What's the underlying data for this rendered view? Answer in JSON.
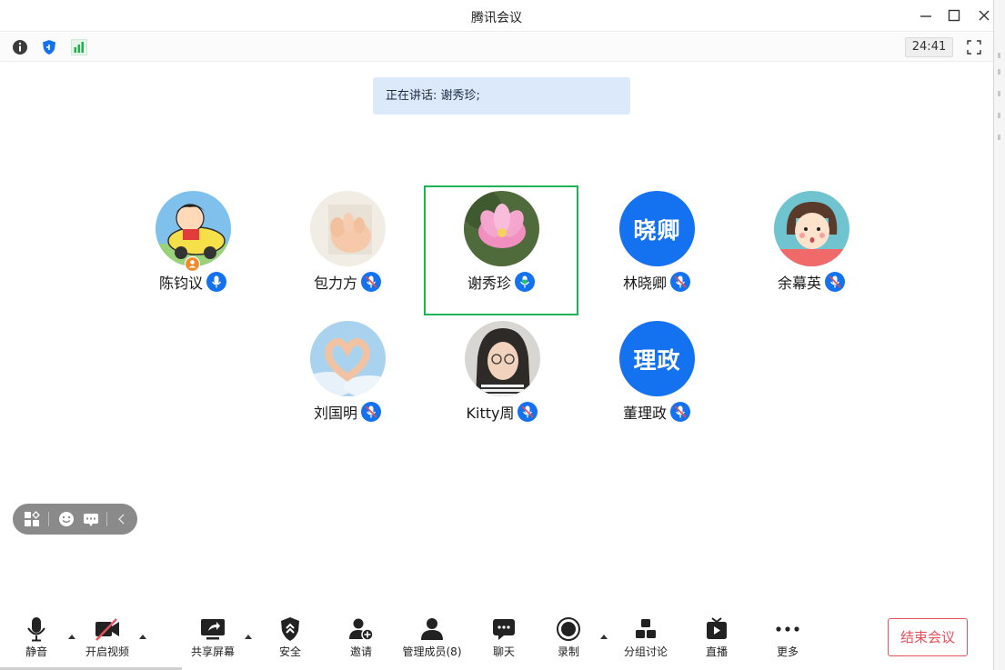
{
  "window": {
    "title": "腾讯会议",
    "minimize_icon": "minimize-icon",
    "maximize_icon": "maximize-icon",
    "close_icon": "close-icon"
  },
  "infobar": {
    "icons": [
      "info-icon",
      "shield-icon",
      "signal-bars-icon"
    ],
    "timer": "24:41",
    "fullscreen_icon": "fullscreen-icon"
  },
  "speaking_banner": "正在讲话: 谢秀珍;",
  "participants": [
    {
      "name": "陈钧议",
      "avatar": "cartoon-car-avatar",
      "is_host": true,
      "mic": "unmuted"
    },
    {
      "name": "包力方",
      "avatar": "baby-hand-avatar",
      "mic": "muted"
    },
    {
      "name": "谢秀珍",
      "avatar": "lotus-flower-avatar",
      "mic": "speaking",
      "active_speaker": true
    },
    {
      "name": "林晓卿",
      "avatar_text": "晓卿",
      "mic": "muted"
    },
    {
      "name": "余幕英",
      "avatar": "cartoon-girl-avatar",
      "mic": "muted"
    },
    {
      "name": "刘国明",
      "avatar": "heart-hands-sky-avatar",
      "mic": "muted"
    },
    {
      "name": "Kitty周",
      "avatar": "woman-glasses-avatar",
      "mic": "muted"
    },
    {
      "name": "董理政",
      "avatar_text": "理政",
      "mic": "muted"
    }
  ],
  "floating_toolbar": {
    "icons": [
      "layout-icon",
      "emoji-icon",
      "subtitle-icon",
      "collapse-chevron-icon"
    ]
  },
  "toolbar": {
    "mute": "静音",
    "video": "开启视频",
    "share": "共享屏幕",
    "security": "安全",
    "invite": "邀请",
    "members": "管理成员(8)",
    "chat": "聊天",
    "record": "录制",
    "breakout": "分组讨论",
    "live": "直播",
    "more": "更多",
    "end_meeting": "结束会议"
  },
  "colors": {
    "accent_blue": "#1471f0",
    "speaking_green": "#1fb358",
    "end_red": "#e8505b",
    "banner_bg": "#dbe9fb"
  }
}
